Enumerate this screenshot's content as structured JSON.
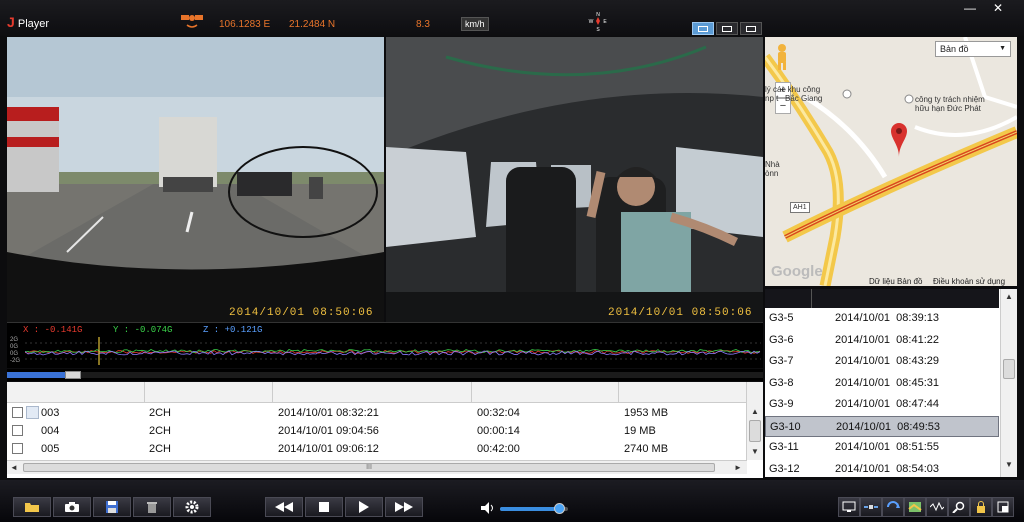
{
  "app": {
    "logo_letter": "J",
    "title": "Player"
  },
  "gps": {
    "longitude": "106.1283 E",
    "latitude": "21.2484 N",
    "speed": "8.3",
    "speed_unit": "km/h"
  },
  "compass": {
    "n": "N",
    "s": "S",
    "w": "W",
    "e": "E"
  },
  "window": {
    "minimize": "—",
    "close": "✕"
  },
  "video": {
    "front_timestamp": "2014/10/01   08:50:06",
    "cabin_timestamp": "2014/10/01   08:50:06"
  },
  "map": {
    "type_select": "Bản đồ",
    "poi1": "lý các khu công\nnp t   Bắc Giang",
    "poi2": "công ty trách nhiệm\nhữu hạn Đức Phát",
    "poi3": "Nhà\nònn",
    "road_label": "AH1",
    "zoom_plus": "+",
    "zoom_minus": "−",
    "logo": "Google",
    "data_link": "Dữ liệu Bản đồ",
    "terms_link": "Điều khoản sử dụng"
  },
  "gsensor": {
    "x": "X : -0.141G",
    "y": "Y : -0.074G",
    "z": "Z : +0.121G",
    "scale_top": "2G",
    "scale_mid_top": "0G",
    "scale_mid": "0G",
    "scale_bottom": "-2G"
  },
  "playback": {
    "progress": 0.1,
    "volume": 0.88
  },
  "files": [
    {
      "no": "003",
      "channel": "2CH",
      "datetime": "2014/10/01 08:32:21",
      "duration": "00:32:04",
      "size": "1953 MB"
    },
    {
      "no": "004",
      "channel": "2CH",
      "datetime": "2014/10/01 09:04:56",
      "duration": "00:00:14",
      "size": "19 MB"
    },
    {
      "no": "005",
      "channel": "2CH",
      "datetime": "2014/10/01 09:06:12",
      "duration": "00:42:00",
      "size": "2740 MB"
    }
  ],
  "events": [
    {
      "id": "G3-5",
      "time": "2014/10/01  08:39:13"
    },
    {
      "id": "G3-6",
      "time": "2014/10/01  08:41:22"
    },
    {
      "id": "G3-7",
      "time": "2014/10/01  08:43:29"
    },
    {
      "id": "G3-8",
      "time": "2014/10/01  08:45:31"
    },
    {
      "id": "G3-9",
      "time": "2014/10/01  08:47:44"
    },
    {
      "id": "G3-10",
      "time": "2014/10/01  08:49:53"
    },
    {
      "id": "G3-11",
      "time": "2014/10/01  08:51:55"
    },
    {
      "id": "G3-12",
      "time": "2014/10/01  08:54:03"
    }
  ],
  "selected_event": "G3-10",
  "scroll": {
    "up": "▲",
    "down": "▼",
    "left": "◄",
    "right": "►",
    "grip": "III"
  },
  "colors": {
    "accent": "#e8742a",
    "stamp": "#f0c040",
    "g_x": "#e83a2e",
    "g_y": "#3ad24a",
    "g_z": "#5aa0ff",
    "progress": "#3a72d6"
  }
}
